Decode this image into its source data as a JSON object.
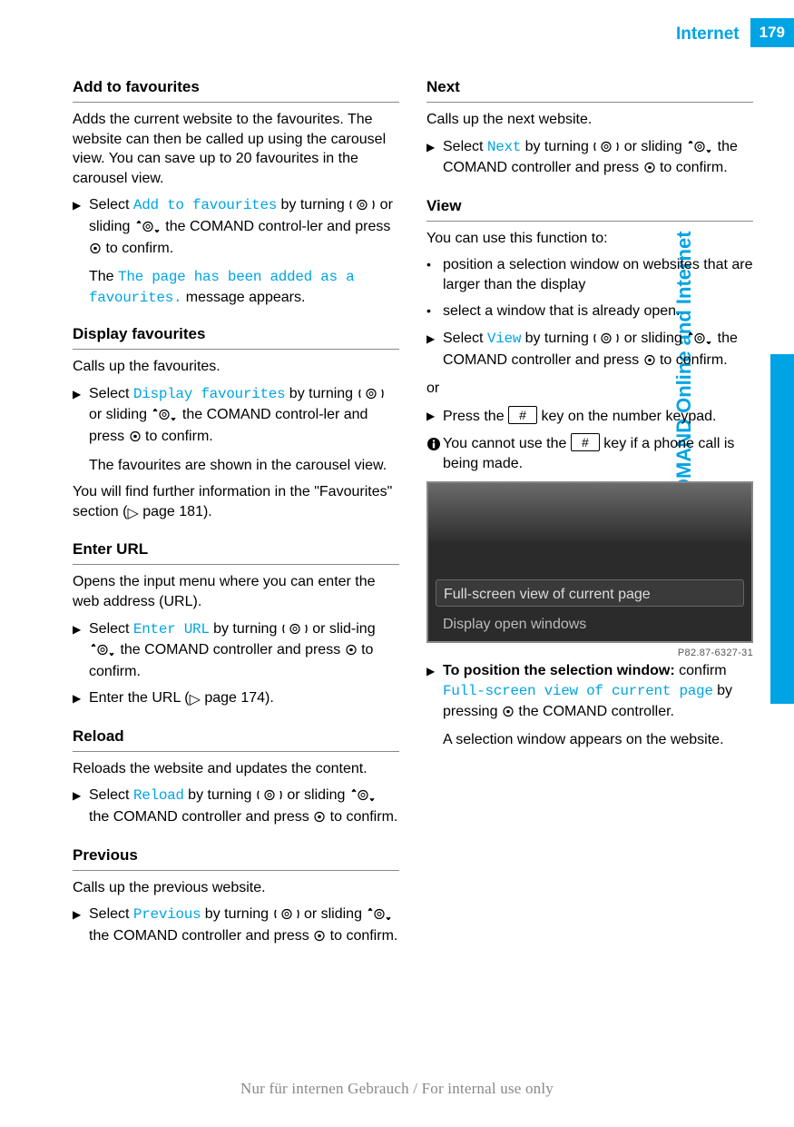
{
  "header": {
    "title": "Internet",
    "page_number": "179"
  },
  "side_tab": "COMAND Online and Internet",
  "icons": {
    "step": "▶",
    "bullet": "•",
    "hash_key": "#",
    "page_ref": "▷"
  },
  "text": {
    "controller_press_confirm": " the COMAND controller and press ",
    "to_confirm": " to confirm.",
    "by_turning": " by turning ",
    "or_sliding": " or sliding ",
    "or_sliding_2": " or slid-",
    "ing": "ing ",
    "comand_controller_press": " the COMAND control-",
    "ler_press": "ler and press "
  },
  "left": {
    "add_fav": {
      "heading": "Add to favourites",
      "p1": "Adds the current website to the favourites. The website can then be called up using the carousel view. You can save up to 20 favourites in the carousel view.",
      "step1_a": "Select ",
      "step1_menu": "Add to favourites",
      "step1_c": "The ",
      "step1_msg": "The page has been added as a favourites.",
      "step1_d": " message appears."
    },
    "disp_fav": {
      "heading": "Display favourites",
      "p1": "Calls up the favourites.",
      "step1_a": "Select ",
      "step1_menu": "Display favourites",
      "step1_c": "The favourites are shown in the carousel view.",
      "p3a": "You will find further information in the \"Favourites\" section (",
      "p3b": " page 181)."
    },
    "enter_url": {
      "heading": "Enter URL",
      "p1": "Opens the input menu where you can enter the web address (URL).",
      "step1_a": "Select ",
      "step1_menu": "Enter URL",
      "step2_a": "Enter the URL (",
      "step2_b": " page 174)."
    },
    "reload": {
      "heading": "Reload",
      "p1": "Reloads the website and updates the content.",
      "step1_a": "Select ",
      "step1_menu": "Reload"
    },
    "previous": {
      "heading": "Previous",
      "p1": "Calls up the previous website.",
      "step1_a": "Select ",
      "step1_menu": "Previous"
    }
  },
  "right": {
    "next": {
      "heading": "Next",
      "p1": "Calls up the next website.",
      "step1_a": "Select ",
      "step1_menu": "Next"
    },
    "view": {
      "heading": "View",
      "p1": "You can use this function to:",
      "b1": "position a selection window on websites that are larger than the display",
      "b2": "select a window that is already open.",
      "step1_a": "Select ",
      "step1_menu": "View",
      "or": "or",
      "step2_a": "Press the ",
      "step2_b": " key on the number keypad.",
      "note_a": "You cannot use the ",
      "note_b": " key if a phone call is being made."
    },
    "screenshot": {
      "row1": "Full-screen view of current page",
      "row2": "Display open windows",
      "caption": "P82.87-6327-31"
    },
    "position": {
      "step1_a": "To position the selection window:",
      "step1_b": " confirm ",
      "step1_menu": "Full-screen view of current page",
      "step1_c": " by pressing ",
      "step1_d": " the COMAND controller.",
      "step1_e": "A selection window appears on the website."
    }
  },
  "footer": "Nur für internen Gebrauch / For internal use only"
}
